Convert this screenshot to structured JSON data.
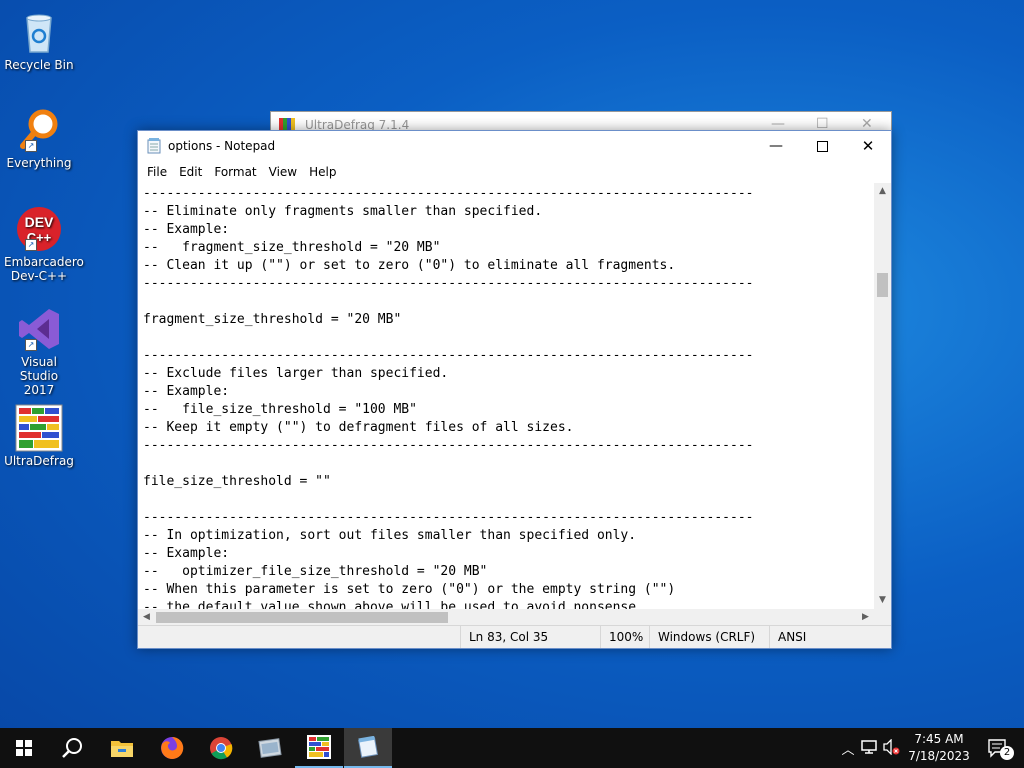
{
  "desktop": {
    "icons": [
      {
        "label": "Recycle Bin"
      },
      {
        "label": "Everything"
      },
      {
        "label": "Embarcadero Dev-C++"
      },
      {
        "label": "Visual Studio 2017"
      },
      {
        "label": "UltraDefrag"
      }
    ]
  },
  "background_window": {
    "title": "UltraDefrag 7.1.4"
  },
  "notepad": {
    "title": "options - Notepad",
    "menu": [
      "File",
      "Edit",
      "Format",
      "View",
      "Help"
    ],
    "text_lines": [
      "------------------------------------------------------------------------------",
      "-- Eliminate only fragments smaller than specified.",
      "-- Example:",
      "--   fragment_size_threshold = \"20 MB\"",
      "-- Clean it up (\"\") or set to zero (\"0\") to eliminate all fragments.",
      "------------------------------------------------------------------------------",
      "",
      "fragment_size_threshold = \"20 MB\"",
      "",
      "------------------------------------------------------------------------------",
      "-- Exclude files larger than specified.",
      "-- Example:",
      "--   file_size_threshold = \"100 MB\"",
      "-- Keep it empty (\"\") to defragment files of all sizes.",
      "------------------------------------------------------------------------------",
      "",
      "file_size_threshold = \"\"",
      "",
      "------------------------------------------------------------------------------",
      "-- In optimization, sort out files smaller than specified only.",
      "-- Example:",
      "--   optimizer_file_size_threshold = \"20 MB\"",
      "-- When this parameter is set to zero (\"0\") or the empty string (\"\")",
      "-- the default value shown above will be used to avoid nonsense"
    ],
    "status": {
      "position": "Ln 83, Col 35",
      "zoom": "100%",
      "line_ending": "Windows (CRLF)",
      "encoding": "ANSI"
    }
  },
  "taskbar": {
    "time": "7:45 AM",
    "date": "7/18/2023",
    "notification_count": "2"
  }
}
